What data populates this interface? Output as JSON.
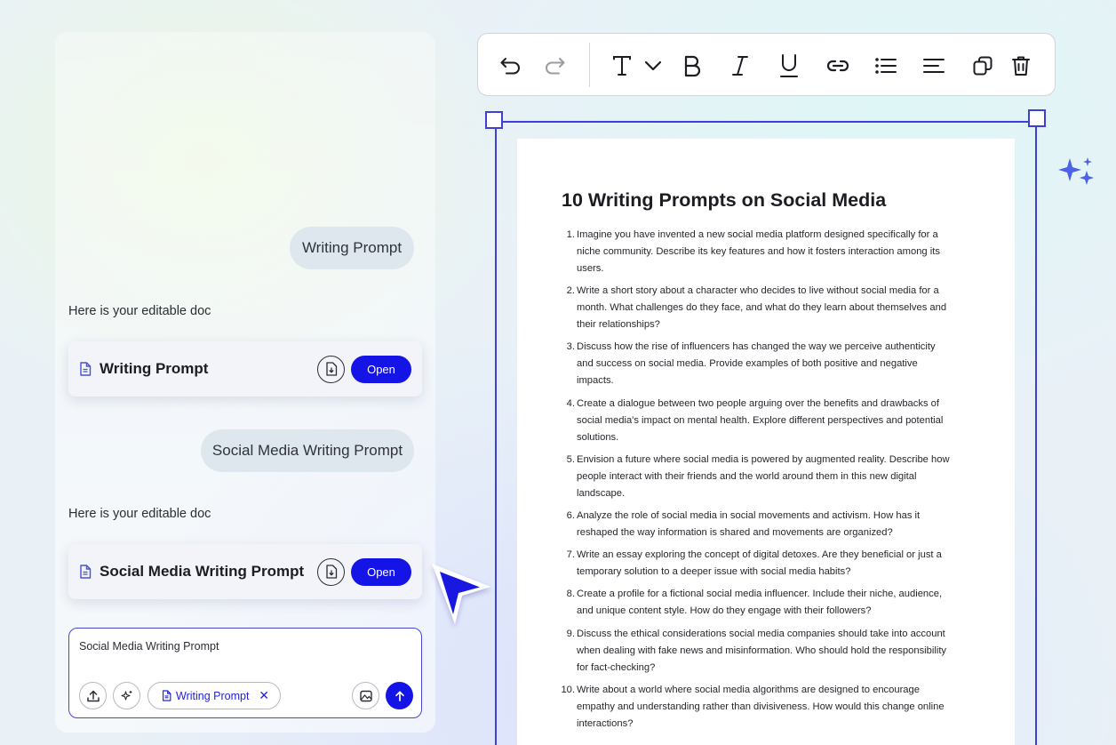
{
  "chat": {
    "messages": [
      {
        "user": "Writing Prompt",
        "reply": "Here is your editable doc",
        "card_title": "Writing Prompt",
        "open_label": "Open"
      },
      {
        "user": "Social Media Writing Prompt",
        "reply": "Here is your editable doc",
        "card_title": "Social Media Writing Prompt",
        "open_label": "Open"
      }
    ],
    "input": {
      "value": "Social Media Writing Prompt",
      "chip_label": "Writing Prompt"
    }
  },
  "toolbar": {
    "buttons": [
      "undo-icon",
      "redo-icon",
      "text-style-icon",
      "chevron-down-icon",
      "bold-icon",
      "italic-icon",
      "underline-icon",
      "link-icon",
      "bullet-list-icon",
      "align-icon",
      "duplicate-icon",
      "delete-icon"
    ]
  },
  "document": {
    "title": "10 Writing Prompts on Social Media",
    "items": [
      {
        "num": "1.",
        "text": "Imagine you have invented a new social media platform designed specifically for a niche community. Describe its key features and how it fosters interaction among its users."
      },
      {
        "num": "2.",
        "text": "Write a short story about a character who decides to live without social media for a month. What challenges do they face, and what do they learn about themselves and their relationships?"
      },
      {
        "num": "3.",
        "text": "Discuss how the rise of influencers has changed the way we perceive authenticity and success on social media. Provide examples of both positive and negative impacts."
      },
      {
        "num": "4.",
        "text": "Create a dialogue between two people arguing over the benefits and drawbacks of social media's impact on mental health. Explore different perspectives and potential solutions."
      },
      {
        "num": "5.",
        "text": "Envision a future where social media is powered by augmented reality. Describe how people interact with their friends and the world around them in this new digital landscape."
      },
      {
        "num": "6.",
        "text": "Analyze the role of social media in social movements and activism. How has it reshaped the way information is shared and movements are organized?"
      },
      {
        "num": "7.",
        "text": "Write an essay exploring the concept of digital detoxes. Are they beneficial or just a temporary solution to a deeper issue with social media habits?"
      },
      {
        "num": "8.",
        "text": "Create a profile for a fictional social media influencer. Include their niche, audience, and unique content style. How do they engage with their followers?"
      },
      {
        "num": "9.",
        "text": "Discuss the ethical considerations social media companies should take into account when dealing with fake news and misinformation. Who should hold the responsibility for fact-checking?"
      },
      {
        "num": "10.",
        "text": "Write about a world where social media algorithms are designed to encourage empathy and understanding rather than divisiveness. How would this change online interactions?"
      }
    ]
  },
  "colors": {
    "accent": "#1414e6",
    "frame": "#3d3fd6",
    "bubble": "#dee7ee"
  }
}
